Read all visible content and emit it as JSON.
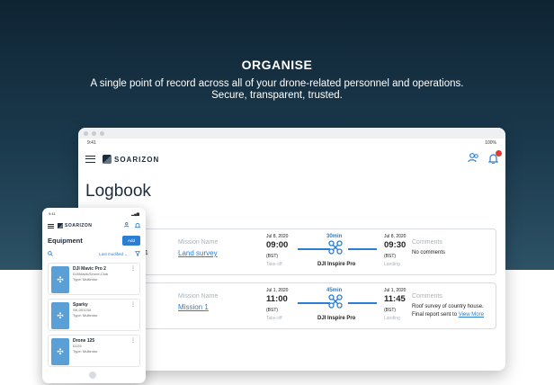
{
  "hero": {
    "title": "ORGANISE",
    "subtitle": "A single point of record across all of your drone-related personnel and operations. Secure, transparent, trusted."
  },
  "tablet": {
    "status_time": "9:41",
    "status_right": "100%",
    "brand": "SOARIZON",
    "page_title": "Logbook",
    "entries": [
      {
        "partial_label": "t 1",
        "mission_label": "Mission Name",
        "mission_name": "Land survey",
        "start_date": "Jul 8, 2020",
        "start_time": "09:00",
        "start_tz": "(BST)",
        "start_label": "Take-off",
        "duration": "30min",
        "drone": "DJI Inspire Pro",
        "end_date": "Jul 8, 2020",
        "end_time": "09:30",
        "end_tz": "(BST)",
        "end_label": "Landing",
        "comments_label": "Comments",
        "comments": "No comments",
        "comments_link": ""
      },
      {
        "partial_label": "",
        "mission_label": "Mission Name",
        "mission_name": "Mission 1",
        "start_date": "Jul 1, 2020",
        "start_time": "11:00",
        "start_tz": "(BST)",
        "start_label": "Take-off",
        "duration": "45min",
        "drone": "DJI Inspire Pro",
        "end_date": "Jul 1, 2020",
        "end_time": "11:45",
        "end_tz": "(BST)",
        "end_label": "Landing",
        "comments_label": "Comments",
        "comments": "Roof survey of country house. Final report sent to",
        "comments_link": "View More"
      }
    ]
  },
  "phone": {
    "status_time": "9:41",
    "brand": "SOARIZON",
    "title": "Equipment",
    "add_label": "Add",
    "sort_label": "Last modified",
    "items": [
      {
        "name": "DJI Mavic Pro 2",
        "line1": "DJI/Mavic/Drone-Club",
        "line2": "Type: Multirotor"
      },
      {
        "name": "Sparky",
        "line1": "SK-001234",
        "line2": "Type: Multirotor"
      },
      {
        "name": "Drone 125",
        "line1": "D125",
        "line2": "Type: Multirotor"
      }
    ]
  },
  "icons": {
    "menu": "menu-icon",
    "users": "users-icon",
    "bell": "bell-icon",
    "drone": "drone-icon",
    "search": "search-icon",
    "filter": "filter-icon"
  },
  "colors": {
    "accent": "#2a7fd4",
    "hero_bg": "#1b3a4e",
    "brand_dark": "#1d2b3a",
    "alert": "#e53935"
  }
}
